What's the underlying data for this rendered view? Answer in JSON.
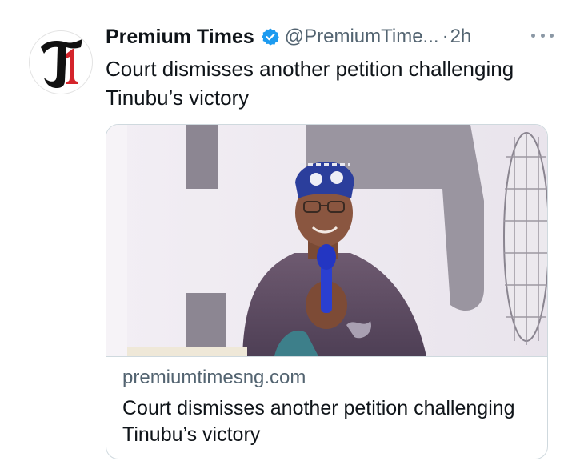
{
  "tweet": {
    "author_name": "Premium Times",
    "handle": "@PremiumTime...",
    "separator": "·",
    "time": "2h",
    "text": "Court dismisses another petition challenging Tinubu’s victory",
    "avatar": {
      "logo_text": "T1",
      "icon": "premium-times-logo-icon"
    },
    "verified_icon": "verified-badge-icon",
    "more_icon": "more-options-icon"
  },
  "card": {
    "domain": "premiumtimesng.com",
    "title": "Court dismisses another petition challenging Tinubu’s victory",
    "image_icon": "speaker-photo"
  },
  "colors": {
    "text": "#0f1419",
    "secondary": "#536471",
    "verified": "#1d9bf0",
    "border": "#cfd9de",
    "logo_red": "#d4242b"
  }
}
